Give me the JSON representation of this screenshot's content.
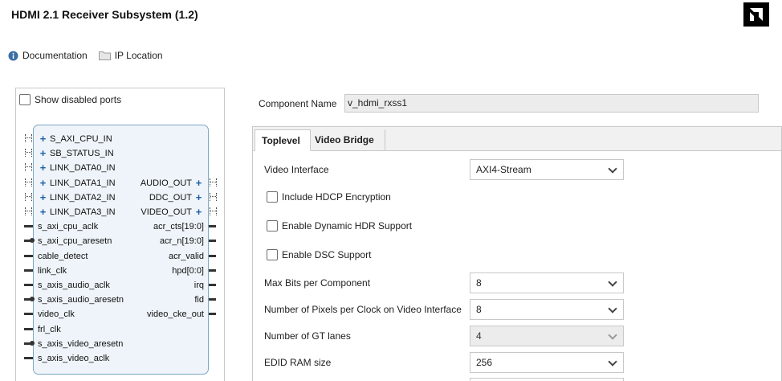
{
  "title": "HDMI 2.1 Receiver Subsystem (1.2)",
  "links": {
    "documentation": "Documentation",
    "ip_location": "IP Location"
  },
  "left_panel": {
    "show_disabled_ports": "Show disabled ports",
    "ports_left": [
      {
        "name": "S_AXI_CPU_IN",
        "type": "bus"
      },
      {
        "name": "SB_STATUS_IN",
        "type": "bus"
      },
      {
        "name": "LINK_DATA0_IN",
        "type": "bus"
      },
      {
        "name": "LINK_DATA1_IN",
        "type": "bus"
      },
      {
        "name": "LINK_DATA2_IN",
        "type": "bus"
      },
      {
        "name": "LINK_DATA3_IN",
        "type": "bus"
      },
      {
        "name": "s_axi_cpu_aclk",
        "type": "wire"
      },
      {
        "name": "s_axi_cpu_aresetn",
        "type": "reset"
      },
      {
        "name": "cable_detect",
        "type": "wire"
      },
      {
        "name": "link_clk",
        "type": "wire"
      },
      {
        "name": "s_axis_audio_aclk",
        "type": "wire"
      },
      {
        "name": "s_axis_audio_aresetn",
        "type": "reset"
      },
      {
        "name": "video_clk",
        "type": "wire"
      },
      {
        "name": "frl_clk",
        "type": "wire"
      },
      {
        "name": "s_axis_video_aresetn",
        "type": "reset"
      },
      {
        "name": "s_axis_video_aclk",
        "type": "wire"
      }
    ],
    "ports_right": [
      {
        "name": "AUDIO_OUT",
        "type": "bus"
      },
      {
        "name": "DDC_OUT",
        "type": "bus"
      },
      {
        "name": "VIDEO_OUT",
        "type": "bus"
      },
      {
        "name": "acr_cts[19:0]",
        "type": "wire"
      },
      {
        "name": "acr_n[19:0]",
        "type": "wire"
      },
      {
        "name": "acr_valid",
        "type": "wire"
      },
      {
        "name": "hpd[0:0]",
        "type": "wire"
      },
      {
        "name": "irq",
        "type": "wire"
      },
      {
        "name": "fid",
        "type": "wire"
      },
      {
        "name": "video_cke_out",
        "type": "wire"
      }
    ]
  },
  "component": {
    "label": "Component Name",
    "value": "v_hdmi_rxss1"
  },
  "tabs": [
    {
      "label": "Toplevel",
      "active": true
    },
    {
      "label": "Video Bridge",
      "active": false
    }
  ],
  "toplevel": {
    "video_interface": {
      "label": "Video Interface",
      "value": "AXI4-Stream"
    },
    "include_hdcp": "Include HDCP Encryption",
    "enable_hdr": "Enable Dynamic HDR Support",
    "enable_dsc": "Enable DSC Support",
    "max_bits": {
      "label": "Max Bits per Component",
      "value": "8"
    },
    "pixels_per_clock": {
      "label": "Number of Pixels per Clock on Video Interface",
      "value": "8"
    },
    "gt_lanes": {
      "label": "Number of GT lanes",
      "value": "4"
    },
    "edid_ram": {
      "label": "EDID RAM size",
      "value": "256"
    }
  },
  "colors": {
    "block_fill": "#eef4f9",
    "block_border": "#7fa7c4",
    "plus_blue": "#1e5fa8",
    "info_icon_blue": "#3a6ea5"
  }
}
